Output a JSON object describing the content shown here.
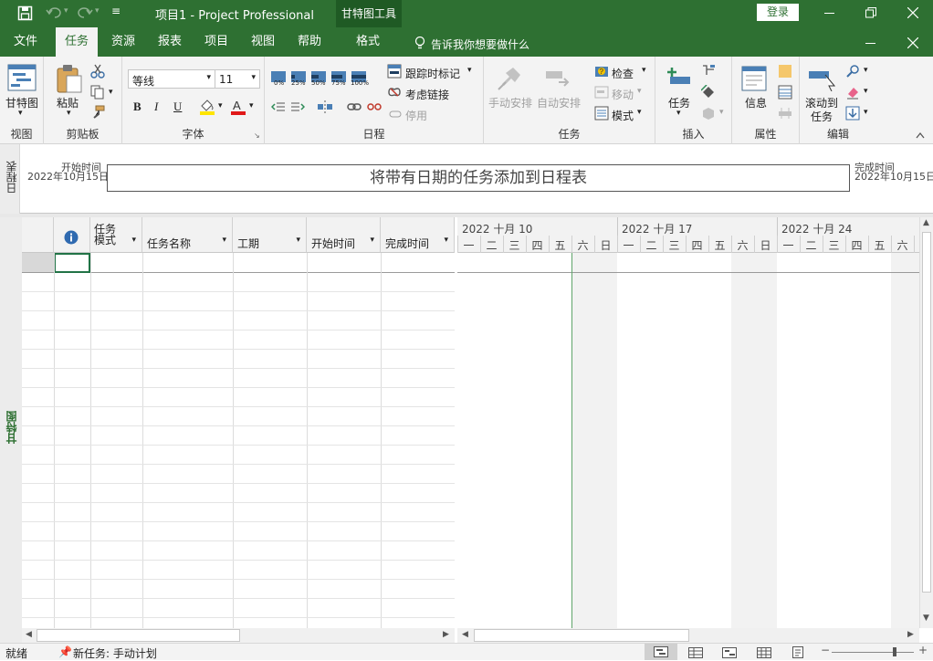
{
  "titlebar": {
    "doc_title": "项目1  -  Project Professional",
    "context_title": "甘特图工具",
    "login": "登录"
  },
  "tabs": [
    "文件",
    "任务",
    "资源",
    "报表",
    "项目",
    "视图",
    "帮助",
    "格式"
  ],
  "active_tab": "任务",
  "tell_me": "告诉我你想要做什么",
  "ribbon": {
    "view": {
      "btn": "甘特图",
      "label": "视图"
    },
    "clipboard": {
      "paste": "粘贴",
      "label": "剪贴板"
    },
    "font": {
      "name": "等线",
      "size": "11",
      "bold": "B",
      "italic": "I",
      "underline": "U",
      "label": "字体"
    },
    "schedule": {
      "pct": [
        "0%",
        "25%",
        "50%",
        "75%",
        "100%"
      ],
      "track": "跟踪时标记",
      "respect": "考虑链接",
      "inactivate": "停用",
      "label": "日程"
    },
    "tasks": {
      "manual": "手动安排",
      "auto": "自动安排",
      "inspect": "检查",
      "move": "移动",
      "mode": "模式",
      "label": "任务"
    },
    "insert": {
      "task": "任务",
      "label": "插入"
    },
    "properties": {
      "info": "信息",
      "label": "属性"
    },
    "editing": {
      "scroll1": "滚动到",
      "scroll2": "任务",
      "label": "编辑"
    }
  },
  "timeline": {
    "side_label": "日程表",
    "start_label": "开始时间",
    "start_date": "2022年10月15日",
    "finish_label": "完成时间",
    "finish_date": "2022年10月15日",
    "placeholder": "将带有日期的任务添加到日程表"
  },
  "sheet": {
    "side_label": "甘特图",
    "columns": [
      "任务\n模式",
      "任务名称",
      "工期",
      "开始时间",
      "完成时间"
    ]
  },
  "gantt": {
    "weeks": [
      "2022 十月 10",
      "2022 十月 17",
      "2022 十月 24"
    ],
    "days": [
      "一",
      "二",
      "三",
      "四",
      "五",
      "六",
      "日"
    ]
  },
  "status": {
    "ready": "就绪",
    "new_task": "新任务: 手动计划"
  },
  "colors": {
    "accent": "#2e7032",
    "context": "#1f5a24"
  }
}
